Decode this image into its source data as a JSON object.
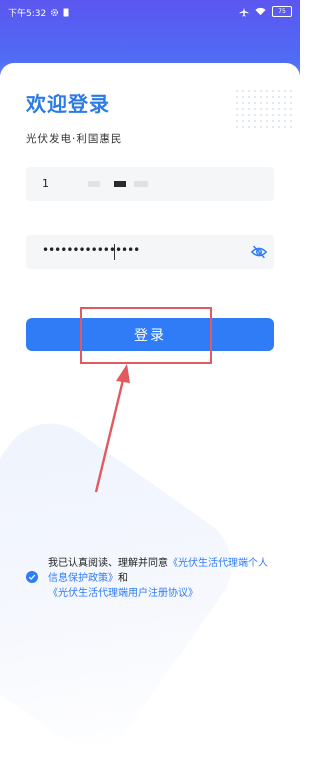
{
  "status_bar": {
    "time": "下午5:32",
    "battery": "75"
  },
  "header": {
    "title": "欢迎登录",
    "subtitle": "光伏发电·利国惠民"
  },
  "phone_field": {
    "value_prefix": "1"
  },
  "password_field": {
    "value": "••••••••••••••••"
  },
  "login_button": {
    "label": "登录"
  },
  "agreement": {
    "text_before": "我已认真阅读、理解并同意",
    "link1": "《光伏生活代理端个人信息保护政策》",
    "text_and": "和",
    "link2": "《光伏生活代理端用户注册协议》",
    "checked": true
  },
  "colors": {
    "accent": "#2f7cf6",
    "annotation": "#e05a5f"
  }
}
